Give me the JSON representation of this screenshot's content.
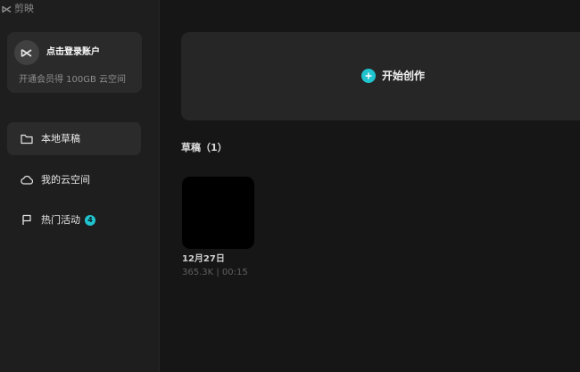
{
  "app": {
    "name": "剪映",
    "brand_color": "#20c4cf"
  },
  "account": {
    "login_label": "点击登录账户",
    "promo_text": "开通会员得 100GB 云空间"
  },
  "sidebar": {
    "items": [
      {
        "label": "本地草稿",
        "icon": "folder-icon",
        "active": true
      },
      {
        "label": "我的云空间",
        "icon": "cloud-icon",
        "active": false
      },
      {
        "label": "热门活动",
        "icon": "flag-icon",
        "active": false,
        "badge": "4"
      }
    ]
  },
  "main": {
    "create_label": "开始创作",
    "drafts_heading": "草稿（1）",
    "drafts": [
      {
        "date": "12月27日",
        "meta": "365.3K | 00:15"
      }
    ]
  }
}
